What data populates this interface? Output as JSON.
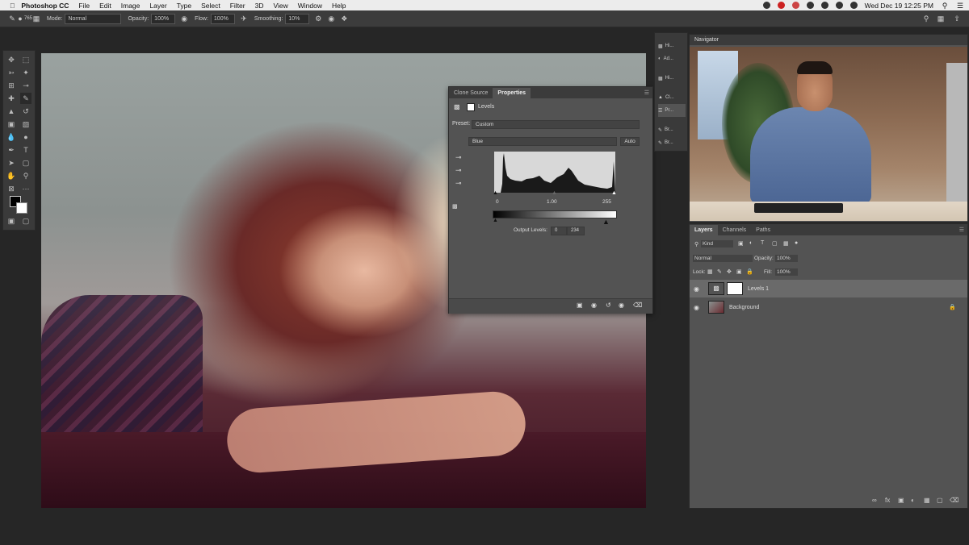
{
  "menubar": {
    "app_name": "Photoshop CC",
    "items": [
      "File",
      "Edit",
      "Image",
      "Layer",
      "Type",
      "Select",
      "Filter",
      "3D",
      "View",
      "Window",
      "Help"
    ],
    "clock": "Wed Dec 19  12:25 PM"
  },
  "options_bar": {
    "brush_size": "765",
    "mode_label": "Mode:",
    "mode_value": "Normal",
    "opacity_label": "Opacity:",
    "opacity_value": "100%",
    "flow_label": "Flow:",
    "flow_value": "100%",
    "smoothing_label": "Smoothing:",
    "smoothing_value": "10%"
  },
  "properties_panel": {
    "tabs": [
      {
        "label": "Clone Source"
      },
      {
        "label": "Properties"
      }
    ],
    "active_tab": "Properties",
    "adjustment_name": "Levels",
    "preset_label": "Preset:",
    "preset_value": "Custom",
    "channel_value": "Blue",
    "auto_label": "Auto",
    "input_black": "0",
    "input_gamma": "1.00",
    "input_white": "255",
    "output_label": "Output Levels:",
    "output_black": "0",
    "output_white": "234"
  },
  "icon_column": {
    "items": [
      {
        "label": "Hi...",
        "icon": "histogram-icon"
      },
      {
        "label": "Ad...",
        "icon": "adjustments-icon"
      },
      {
        "label": "Hi...",
        "icon": "history-icon"
      },
      {
        "label": "Cl...",
        "icon": "clone-stamp-icon"
      },
      {
        "label": "Pr...",
        "icon": "properties-icon"
      },
      {
        "label": "Br...",
        "icon": "brush-icon"
      },
      {
        "label": "Br...",
        "icon": "brush-settings-icon"
      }
    ]
  },
  "navigator": {
    "title": "Navigator"
  },
  "layers_panel": {
    "tabs": [
      {
        "label": "Layers"
      },
      {
        "label": "Channels"
      },
      {
        "label": "Paths"
      }
    ],
    "active_tab": "Layers",
    "filter_value": "Kind",
    "blend_mode": "Normal",
    "opacity_label": "Opacity:",
    "opacity_value": "100%",
    "lock_label": "Lock:",
    "fill_label": "Fill:",
    "fill_value": "100%",
    "layers": [
      {
        "name": "Levels 1",
        "selected": true
      },
      {
        "name": "Background",
        "selected": false
      }
    ]
  },
  "colors": {
    "panel_bg": "#535353",
    "app_bg": "#262626",
    "accent": "#2b6fd1"
  }
}
